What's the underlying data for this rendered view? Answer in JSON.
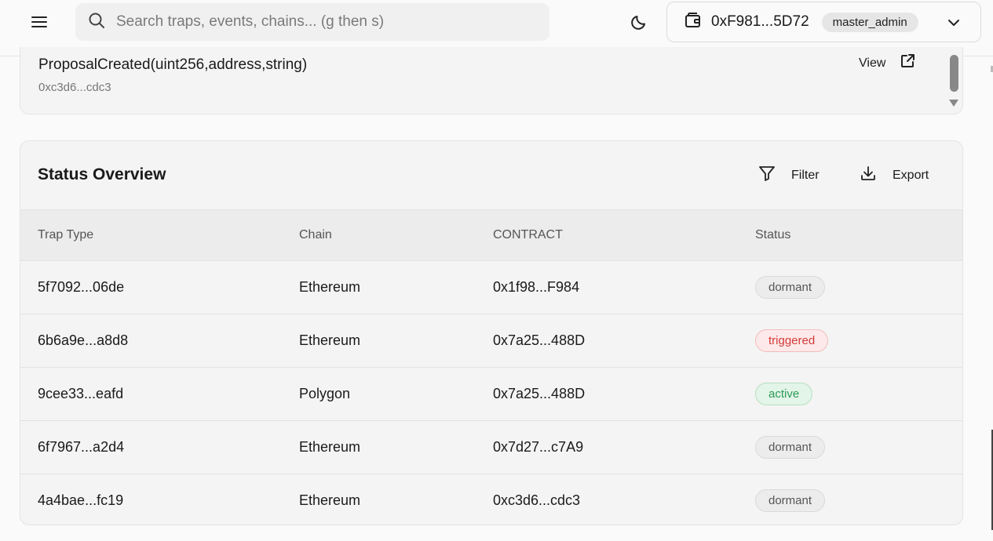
{
  "header": {
    "search_placeholder": "Search traps, events, chains... (g then s)",
    "wallet_address": "0xF981...5D72",
    "role": "master_admin"
  },
  "event": {
    "signature": "ProposalCreated(uint256,address,string)",
    "address": "0xc3d6...cdc3",
    "view_label": "View"
  },
  "status_overview": {
    "title": "Status Overview",
    "filter_label": "Filter",
    "export_label": "Export",
    "columns": [
      "Trap Type",
      "Chain",
      "CONTRACT",
      "Status"
    ],
    "rows": [
      {
        "trap": "5f7092...06de",
        "chain": "Ethereum",
        "contract": "0x1f98...F984",
        "status": "dormant"
      },
      {
        "trap": "6b6a9e...a8d8",
        "chain": "Ethereum",
        "contract": "0x7a25...488D",
        "status": "triggered"
      },
      {
        "trap": "9cee33...eafd",
        "chain": "Polygon",
        "contract": "0x7a25...488D",
        "status": "active"
      },
      {
        "trap": "6f7967...a2d4",
        "chain": "Ethereum",
        "contract": "0x7d27...c7A9",
        "status": "dormant"
      },
      {
        "trap": "4a4bae...fc19",
        "chain": "Ethereum",
        "contract": "0xc3d6...cdc3",
        "status": "dormant"
      }
    ]
  },
  "colors": {
    "dormant": "#555555",
    "triggered": "#d33a3a",
    "active": "#2a9c55"
  }
}
